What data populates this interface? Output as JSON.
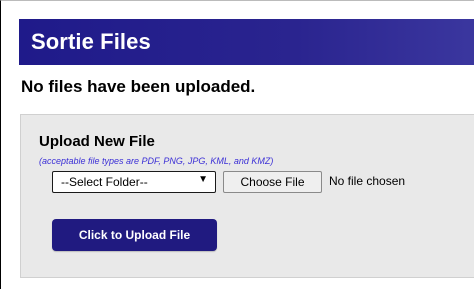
{
  "header": {
    "title": "Sortie Files"
  },
  "status": {
    "message": "No files have been uploaded."
  },
  "upload": {
    "title": "Upload New File",
    "note": "(acceptable file types are PDF, PNG, JPG, KML, and KMZ)",
    "folder_select_value": "--Select Folder--",
    "choose_file_label": "Choose File",
    "no_file_chosen": "No file chosen",
    "upload_button_label": "Click to Upload File"
  },
  "colors": {
    "header_background": "#2a248f",
    "panel_background": "#e9e9e9",
    "note_text": "#3b2fd6",
    "upload_button": "#201a80"
  }
}
